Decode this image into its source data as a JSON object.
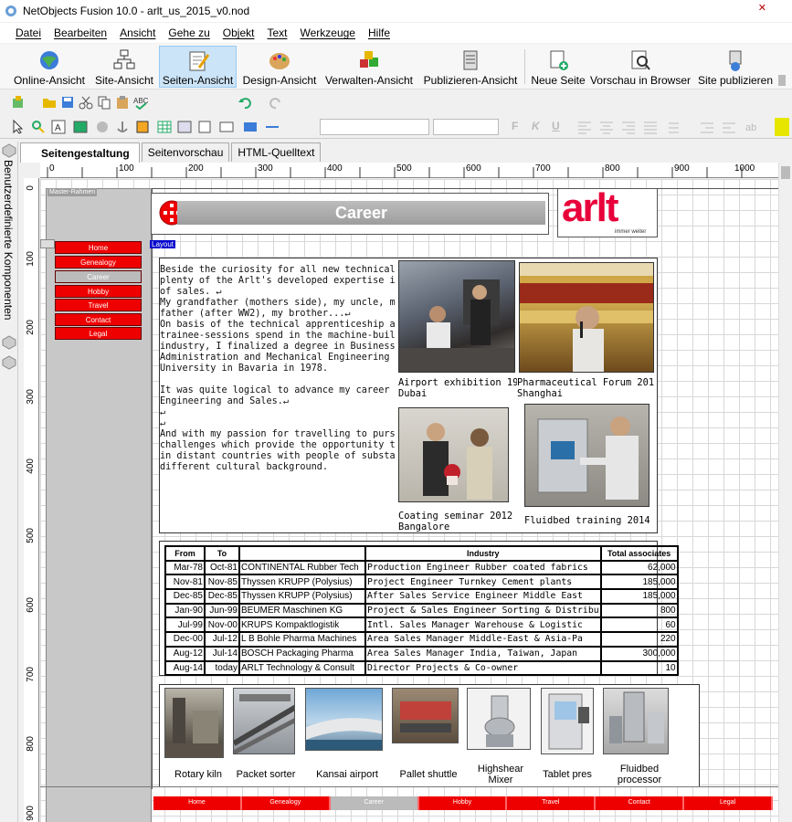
{
  "window": {
    "title": "NetObjects Fusion 10.0 - arlt_us_2015_v0.nod",
    "close": "✕"
  },
  "menu": [
    "Datei",
    "Bearbeiten",
    "Ansicht",
    "Gehe zu",
    "Objekt",
    "Text",
    "Werkzeuge",
    "Hilfe"
  ],
  "toolbar": {
    "views": [
      "Online-Ansicht",
      "Site-Ansicht",
      "Seiten-Ansicht",
      "Design-Ansicht",
      "Verwalten-Ansicht",
      "Publizieren-Ansicht"
    ],
    "actions": [
      "Neue Seite",
      "Vorschau in Browser",
      "Site publizieren"
    ],
    "active_view": "Seiten-Ansicht",
    "format_letters": [
      "F",
      "K",
      "U"
    ]
  },
  "side_panel": {
    "label": "Benutzerdefinierte Komponenten"
  },
  "tabs": [
    "Seitengestaltung",
    "Seitenvorschau",
    "HTML-Quelltext"
  ],
  "ruler": {
    "h_labels": [
      "0",
      "100",
      "200",
      "300",
      "400",
      "500",
      "600",
      "700",
      "800",
      "900",
      "1000"
    ],
    "v_labels": [
      "0",
      "100",
      "200",
      "300",
      "400",
      "500",
      "600",
      "700",
      "800",
      "900"
    ]
  },
  "canvas": {
    "master_label": "Master-Rahmen",
    "layout_label": "Layout",
    "banner_title": "Career",
    "logo": {
      "text": "arlt",
      "tagline": "immer weiter"
    },
    "nav": [
      "Home",
      "Genealogy",
      "Career",
      "Hobby",
      "Travel",
      "Contact",
      "Legal"
    ],
    "current_nav": "Career",
    "story": "Beside the curiosity for all new technical matte\nplenty of the Arlt's developed expertise in the\nof sales. ↵\nMy grandfather (mothers side), my uncle, my\nfather (after WW2), my brother...↵\nOn basis of the technical apprenticeship and s\ntrainee-sessions spend in the machine-builde\nindustry, I finalized a degree in Business\nAdministration and Mechanical Engineering at\nUniversity in Bavaria in 1978.\n\nIt was quite logical to advance my career into\nEngineering and Sales.↵\n↵\n↵\nAnd with my passion for travelling to pursue\nchallenges which provide the opportunity to wo\nin distant countries with people of substantial\ndifferent cultural background.",
    "photos": [
      {
        "caption": "Airport exhibition 1996\nDubai"
      },
      {
        "caption": "Pharmaceutical Forum 201\nShanghai"
      },
      {
        "caption": "Coating seminar 2012\nBangalore"
      },
      {
        "caption": "Fluidbed training 2014 To"
      }
    ],
    "table": {
      "headers": [
        "From",
        "To",
        "",
        "Industry",
        "Total associates"
      ],
      "rows": [
        [
          "Mar-78",
          "Oct-81",
          "CONTINENTAL Rubber Tech",
          "Production Engineer Rubber coated fabrics",
          "62,000"
        ],
        [
          "Nov-81",
          "Nov-85",
          "Thyssen KRUPP (Polysius)",
          "Project Engineer Turnkey Cement plants",
          "185,000"
        ],
        [
          "Dec-85",
          "Dec-85",
          "Thyssen KRUPP (Polysius)",
          "After Sales Service Engineer Middle East",
          "185,000"
        ],
        [
          "Jan-90",
          "Jun-99",
          "BEUMER Maschinen KG",
          "Project & Sales Engineer Sorting & Distribu",
          "800"
        ],
        [
          "Jul-99",
          "Nov-00",
          "KRUPS Kompaktlogistik",
          "Intl. Sales Manager Warehouse & Logistic",
          "60"
        ],
        [
          "Dec-00",
          "Jul-12",
          "L B Bohle Pharma Machines",
          "Area Sales Manager Middle-East & Asia-Pa",
          "220"
        ],
        [
          "Aug-12",
          "Jul-14",
          "BOSCH Packaging Pharma",
          "Area Sales Manager India, Taiwan, Japan",
          "300,000"
        ],
        [
          "Aug-14",
          "today",
          "ARLT Technology & Consult",
          "Director Projects & Co-owner",
          "10"
        ]
      ]
    },
    "gallery": [
      "Rotary kiln",
      "Packet sorter",
      "Kansai airport",
      "Pallet shuttle",
      "Highshear\nMixer",
      "Tablet pres",
      "Fluidbed\nprocessor"
    ]
  },
  "colors": {
    "nav_red": "#e00000",
    "nav_current": "#bbbbbb",
    "banner_grey": "#a8a8a8",
    "logo_red": "#e8003a",
    "layout_tag": "#0000cc"
  }
}
